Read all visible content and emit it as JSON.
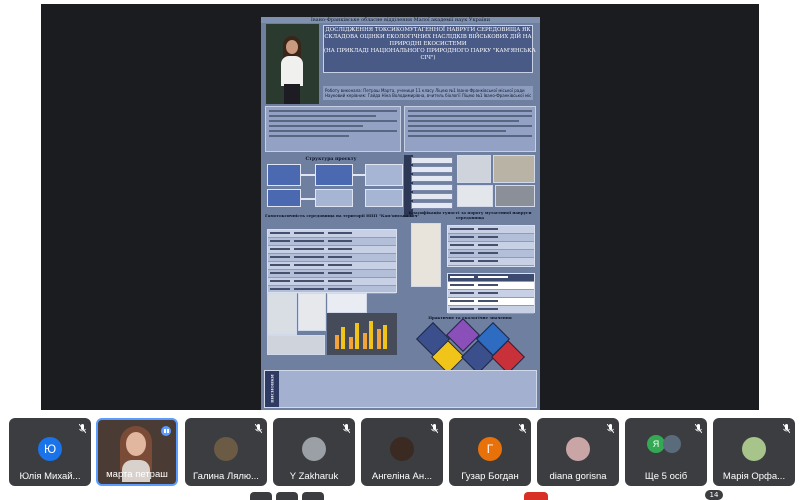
{
  "poster": {
    "institution": "Івано-Франківське обласне відділення Малої академії наук України",
    "title_lines": [
      "ДОСЛІДЖЕННЯ ТОКСИКОМУТАГЕННОЇ НАВРУГИ СЕРЕДОВИЩА ЯК",
      "СКЛАДОВА ОЦІНКИ ЕКОЛОГІЧНИХ НАСЛІДКІВ ВІЙСЬКОВИХ ДІЙ НА",
      "ПРИРОДНІ ЕКОСИСТЕМИ",
      "(НА ПРИКЛАДІ НАЦІОНАЛЬНОГО ПРИРОДНОГО ПАРКУ \"КАМ'ЯНСЬКА",
      "СІЧ\")"
    ],
    "author_line": "Роботу виконала: Петраш Марта, учениця 11 класу Ліцею №1 Івано-Франківської міської ради",
    "supervisor_line": "Науковий керівник: Гайда Ніна Володимирівна, вчитель біології Ліцею №1 Івано-Франківської міської ради",
    "section_project_structure": "Структура проєкту",
    "section_methods": "Методи",
    "section_pollution_map": "Гамотоксичність середовища на території НПП \"Кам'янська Січ\"",
    "section_cells": "Класифікація тупості за порогу мутагенної навруги середовища",
    "section_practical": "Практичне та екологічне значення",
    "section_conclusions": "ВИСНОВКИ"
  },
  "participants": [
    {
      "name": "Юлія Михай...",
      "initials": "Ю",
      "color": "#1a73e8",
      "type": "initials",
      "muted": true
    },
    {
      "name": "марта петраш",
      "type": "video",
      "speaking": true
    },
    {
      "name": "Галина Лялю...",
      "type": "photo",
      "photo_color": "#6b5a44",
      "muted": true
    },
    {
      "name": "Y Zakharuk",
      "type": "photo",
      "photo_color": "#9aa0a6",
      "muted": true
    },
    {
      "name": "Ангеліна Ан...",
      "type": "photo",
      "photo_color": "#3a2a22",
      "muted": true
    },
    {
      "name": "Гузар Богдан",
      "initials": "Г",
      "color": "#e8710a",
      "type": "initials",
      "muted": true
    },
    {
      "name": "diana gorisna",
      "type": "photo",
      "photo_color": "#c9a5a5",
      "muted": true
    },
    {
      "name": "Ще 5 осіб",
      "type": "group",
      "group_initial": "Я",
      "group_color": "#34a853",
      "muted": true
    },
    {
      "name": "Марія Орфа...",
      "type": "photo",
      "photo_color": "#a7c58a",
      "muted": true
    }
  ],
  "participant_count": "14"
}
